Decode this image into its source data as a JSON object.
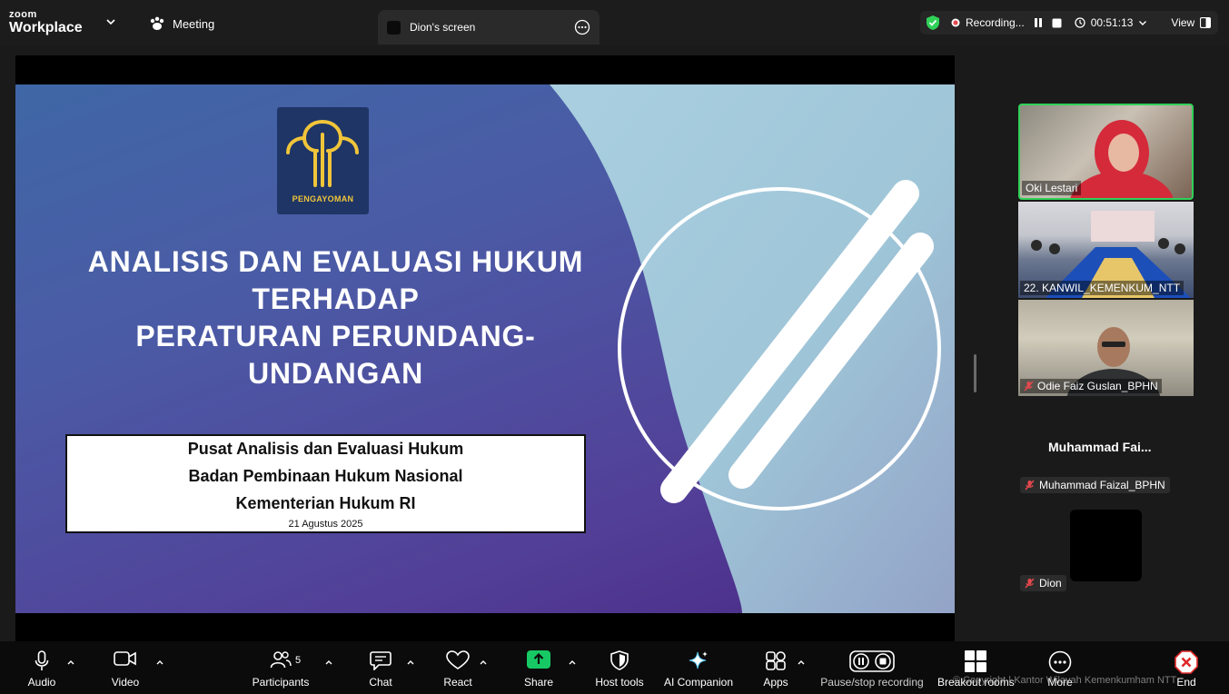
{
  "app": {
    "brand_top": "zoom",
    "brand_bottom": "Workplace"
  },
  "tabs": {
    "meeting": "Meeting",
    "screen": "Dion's screen"
  },
  "status": {
    "recording": "Recording...",
    "timer": "00:51:13",
    "view": "View"
  },
  "slide": {
    "logo_text": "PENGAYOMAN",
    "title_lines": [
      "ANALISIS DAN EVALUASI HUKUM",
      "TERHADAP",
      "PERATURAN PERUNDANG-",
      "UNDANGAN"
    ],
    "info_lines": [
      "Pusat Analisis dan Evaluasi Hukum",
      "Badan Pembinaan Hukum Nasional",
      "Kementerian Hukum RI"
    ],
    "date": "21 Agustus 2025"
  },
  "participants_panel": {
    "tiles": [
      {
        "name": "Oki Lestari",
        "muted": false,
        "active_speaker": true
      },
      {
        "name": "22. KANWIL_KEMENKUM_NTT",
        "muted": false
      },
      {
        "name": "Odie Faiz Guslan_BPHN",
        "muted": true
      }
    ],
    "large_name": "Muhammad  Fai...",
    "chip_muhammad": "Muhammad Faizal_BPHN",
    "chip_dion": "Dion"
  },
  "toolbar": {
    "audio": "Audio",
    "video": "Video",
    "participants": "Participants",
    "participants_count": "5",
    "chat": "Chat",
    "react": "React",
    "share": "Share",
    "host_tools": "Host tools",
    "ai_companion": "AI Companion",
    "apps": "Apps",
    "pause_recording": "Pause/stop recording",
    "breakout_rooms": "Breakout rooms",
    "more": "More",
    "end": "End"
  },
  "watermark": "© Copyright | Kantor Wilayah Kemenkumham NTT",
  "colors": {
    "accent_green": "#30d158",
    "share_green": "#17c964",
    "end_red": "#e02828",
    "recording_red": "#e5484d"
  }
}
